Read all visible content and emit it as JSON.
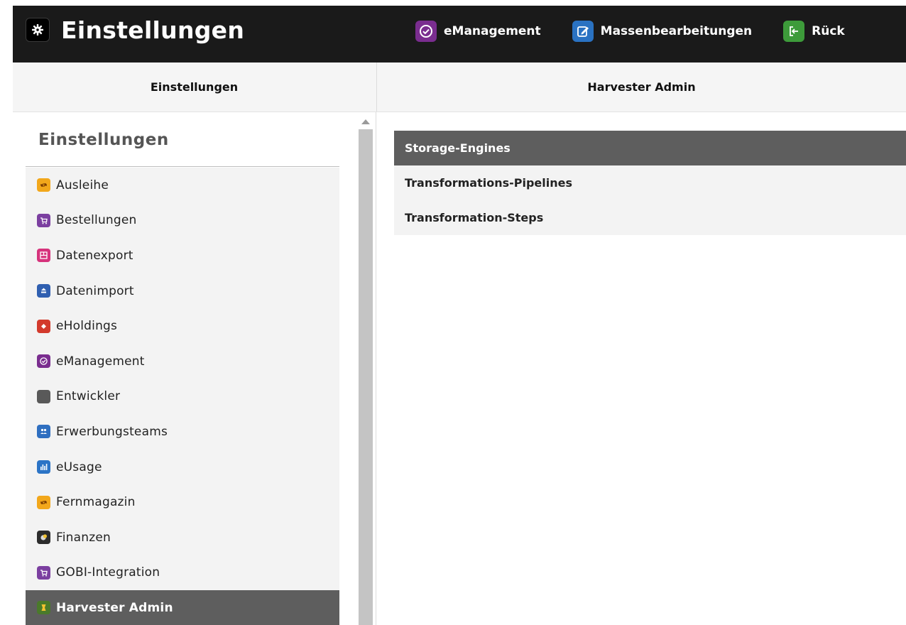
{
  "app": {
    "title": "Einstellungen",
    "nav": [
      {
        "label": "eManagement",
        "icon": "emanagement-check-icon",
        "color": "#7a2d8f"
      },
      {
        "label": "Massenbearbeitungen",
        "icon": "edit-icon",
        "color": "#2a72c2"
      },
      {
        "label": "Rück",
        "icon": "checkout-return-icon",
        "color": "#3d9b3a"
      }
    ]
  },
  "panes": {
    "left_header": "Einstellungen",
    "right_header": "Harvester Admin"
  },
  "settings_nav": {
    "heading": "Einstellungen",
    "items": [
      {
        "label": "Ausleihe",
        "icon": "circulation-icon",
        "color": "#f2a71b"
      },
      {
        "label": "Bestellungen",
        "icon": "orders-icon",
        "color": "#7b3fa0"
      },
      {
        "label": "Datenexport",
        "icon": "data-export-icon",
        "color": "#d6337c"
      },
      {
        "label": "Datenimport",
        "icon": "data-import-icon",
        "color": "#2f5fb0"
      },
      {
        "label": "eHoldings",
        "icon": "eholdings-icon",
        "color": "#d33a2c"
      },
      {
        "label": "eManagement",
        "icon": "emanagement-icon",
        "color": "#7a2d8f"
      },
      {
        "label": "Entwickler",
        "icon": "developer-icon",
        "color": "#595959"
      },
      {
        "label": "Erwerbungsteams",
        "icon": "acquisition-units-icon",
        "color": "#2f6fc0"
      },
      {
        "label": "eUsage",
        "icon": "eusage-chart-icon",
        "color": "#2b74c6"
      },
      {
        "label": "Fernmagazin",
        "icon": "remote-storage-icon",
        "color": "#f2a71b"
      },
      {
        "label": "Finanzen",
        "icon": "finance-icon",
        "color": "#2c2c2c"
      },
      {
        "label": "GOBI-Integration",
        "icon": "gobi-integration-icon",
        "color": "#7b3fa0"
      },
      {
        "label": "Harvester Admin",
        "icon": "harvester-icon",
        "color": "#4a7a2a",
        "active": true
      }
    ]
  },
  "harvester": {
    "items": [
      {
        "label": "Storage-Engines",
        "active": true
      },
      {
        "label": "Transformations-Pipelines"
      },
      {
        "label": "Transformation-Steps"
      }
    ]
  }
}
